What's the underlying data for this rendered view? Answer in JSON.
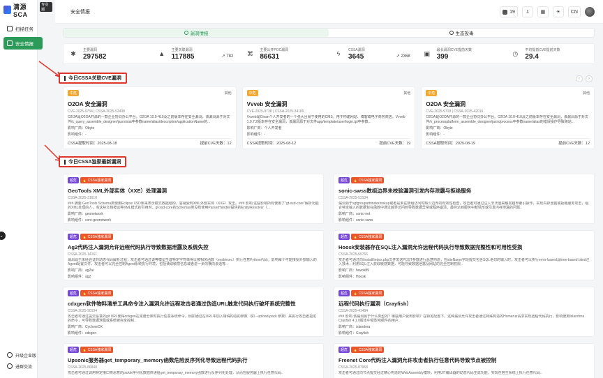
{
  "app": {
    "logo_text": "清源SCA",
    "logo_badge": "专业版"
  },
  "sidebar": {
    "items": [
      {
        "label": "扫描任务",
        "icon": "scan-icon",
        "active": false
      },
      {
        "label": "安全情报",
        "icon": "shield-icon",
        "active": true
      }
    ],
    "bottom": [
      {
        "label": "升级企业版",
        "icon": "upgrade-icon"
      },
      {
        "label": "进群交流",
        "icon": "wechat-icon"
      }
    ]
  },
  "header": {
    "breadcrumb": "安全情报",
    "notification_count": "19",
    "language": "CN"
  },
  "tabs": [
    {
      "label": "漏洞情报",
      "active": true
    },
    {
      "label": "生态投毒",
      "active": false
    }
  ],
  "stats": [
    {
      "label": "主要漏洞",
      "value": "297582",
      "icon": "bug-icon",
      "trend": ""
    },
    {
      "label": "主要关联漏洞",
      "value": "117885",
      "icon": "warning-icon",
      "trend": "782"
    },
    {
      "label": "主要公开POC漏洞",
      "value": "86631",
      "icon": "poc-icon",
      "trend": ""
    },
    {
      "label": "CSSA漏洞",
      "value": "3645",
      "icon": "bolt-icon",
      "trend": "2368"
    },
    {
      "label": "最长漏洞CVE提前天数",
      "value": "399",
      "icon": "calendar-icon",
      "trend": ""
    },
    {
      "label": "平均提前CVE提前天数",
      "value": "29.4",
      "icon": "clock-icon",
      "trend": ""
    }
  ],
  "section1": {
    "title": "今日CSSA关联CVE漏洞"
  },
  "section2": {
    "title": "今日CSSA独家最新漏洞"
  },
  "cve_cards": [
    {
      "level": "中危",
      "category": "其他",
      "title": "O2OA 安全漏洞",
      "cve": "CVE-2025-9734",
      "cssa": "CSSA-2025-52498",
      "desc": "O2OA是O2OA开源的一款企业协同办公平台。O2OA 10.0-410及之前版本存在安全漏洞，该漏洞源于对文件/x_query_assemble_designer/jaxrs/stat中参数name/alias/description/applicationName的...",
      "vendor": "影响厂商：Obyte",
      "component": "影响组件：-",
      "time": "CSSA提取时间：2025-08-18",
      "days": "提前CVE天数：12"
    },
    {
      "level": "中危",
      "category": "其他",
      "title": "Vvveb 安全漏洞",
      "cve": "CVE-2025-9738",
      "cssa": "CSSA-2025-34189",
      "desc": "Vvveb是Givan个人开发者的一个强大且易于使用的CMS，用于构建网站、博客或电子商务商店。Vvveb 1.0.7.2版本存在安全漏洞，该漏洞源于对文件app/template/user/login.tpl中参数...",
      "vendor": "影响厂商：个人开发者",
      "component": "影响组件：-",
      "time": "CSSA提取时间：2025-08-12",
      "days": "提前CVE天数：19"
    },
    {
      "level": "中危",
      "category": "其他",
      "title": "O2OA 安全漏洞",
      "cve": "CVE-2025-9718",
      "cssa": "CSSA-2025-42016",
      "desc": "O2OA是O2OA开源的一款企业协同办公平台。O2OA 10.0-410及之前版本存在安全漏洞，该漏洞源于对文件/x_processplatform_assemble_designer/jaxrs/process中参数name/alias的错误操作导致跨站...",
      "vendor": "影响厂商：Obyte",
      "component": "影响组件：-",
      "time": "CSSA提取时间：2025-08-19",
      "days": "提前CVE天数：12"
    }
  ],
  "exclusive": [
    {
      "level": "超危",
      "tag": "CSSA独家漏洞",
      "title": "GeoTools XML外部实体（XXE）处理漏洞",
      "id": "CSSA-2025-31610",
      "desc": "### 摘要 GeoTools Schema类使用Eclipse XSD库来表示模式数据结构，容易受到XML外部实体（XXE）攻击。### 影响 这些影响所有使用了\"gt-xsd-core\"解析功能的XML处理的人，当这些文档按这种XML模式的引用时，gt-xsd-core的Schemas类没有使用ParserHandler提供的EntityResolver（...",
      "vendor": "影响厂商：geonetwork",
      "component": "影响组件：core-geonetwork"
    },
    {
      "level": "超危",
      "tag": "CSSA独家漏洞",
      "title": "sonic-swss数组边界未校验漏洞引发内存泄露与拒绝服务",
      "id": "CSSA-2025-53104",
      "desc": "漏洞源于sgfgroupattrindexlookup或者是未在数组访问时缺少边界的有效性检查，攻击者可通过注入非法值来触发越界索引操作，实现内存泄露或拒绝服务攻击，组合特定输入的数据包在函数中通过越界访问到导致数据异常或程序崩溃，最终达到服务中断情形或引发内存泄漏的问题..",
      "vendor": "影响厂商：sonic-net",
      "component": "影响组件：sonic-swss"
    },
    {
      "level": "超危",
      "tag": "CSSA独家漏洞",
      "title": "Ag2代码注入漏洞允许远程代码执行导致数据泄露及系统失控",
      "id": "CSSA-2025-14161",
      "desc": "漏洞源于未经验证的动态代码解析过程，攻击者可通过该等模型生成特定字符串得以被相关函数（eval/exec）执行任意Python代码，影响每个可能接受外部输入的Agent配置文件，攻击者可以完全控制Agent系统执行环境，包括读取敏感信息或者进一步的横向渗透等..",
      "vendor": "影响厂商：ag2ai",
      "component": "影响组件：ag2"
    },
    {
      "level": "超危",
      "tag": "CSSA独家漏洞",
      "title": "Hoosk安装器存在SQL注入漏洞允许远程代码执行导致数据完整性和可用性受损",
      "id": "CSSA-2025-59766",
      "desc": "攻击者可通过向/install/index.php文件发送POST参数进行恶意构造，在siteName字段提交包含SQL语句的输入时，攻击者可以执行error-based及time-based blind注入技术，利用SQL注入获取敏感数据，可能导致数据泄露及网站的完全控制权限..",
      "vendor": "影响厂商：havok89",
      "component": "影响组件：Hoosk"
    },
    {
      "level": "超危",
      "tag": "CSSA独家漏洞",
      "title": "cdxgen软件物料清单工具命令注入漏洞允许远程攻击者通过伪造URL触发代码执行破坏系统完整性",
      "id": "CSSA-2025-90134",
      "desc": "攻击者可通过提交恶意的git URL使得cdxgen在克隆仓库时执行任意系统命令，例如通过在URL中加入特殊构造的参数（如 --upload-pack 参数）来执行攻击者指定的命令，可导致数据泄露或系统被完全控制..",
      "vendor": "影响厂商：CycloneDX",
      "component": "影响组件：cdxgen"
    },
    {
      "level": "超危",
      "tag": "CSSA独家漏洞",
      "title": "远程代码执行漏洞（Crayfish）",
      "id": "CSSA-2025-41484",
      "desc": "### 影响 该漏洞属于什么类型的？哪些用户受到影响？在特定配置下，这种漏洞允许攻击者通过特殊构造的Homarus请求实现远程代码执行，影响使用Islandora Crayfish 4.1.0版本中受影响组件的用户..",
      "vendor": "影响厂商：islandora",
      "component": "影响组件：Crayfish"
    },
    {
      "level": "超危",
      "tag": "CSSA独家漏洞",
      "title": "Upsonic服务器get_temporary_memory函数危险反序列化导致远程代码执行",
      "id": "CSSA-2025-86840",
      "desc": "攻击者可通过调用特定接口将恶意的pickle序列化数据传递给get_temporary_memory函数进行反序列化处理，从而在服务器上执行任意代码..",
      "vendor": "",
      "component": ""
    },
    {
      "level": "超危",
      "tag": "CSSA独家漏洞",
      "title": "Freenet Core代码注入漏洞允许攻击者执行任意代码导致节点被控制",
      "id": "CSSA-2025-87968",
      "desc": "攻击者可通过向节点提交经过精心构造的WebAssembly模块，利用JIT编译器的动态代码生成功能，实现在宿主系统上执行任意代码..",
      "vendor": "",
      "component": ""
    }
  ]
}
